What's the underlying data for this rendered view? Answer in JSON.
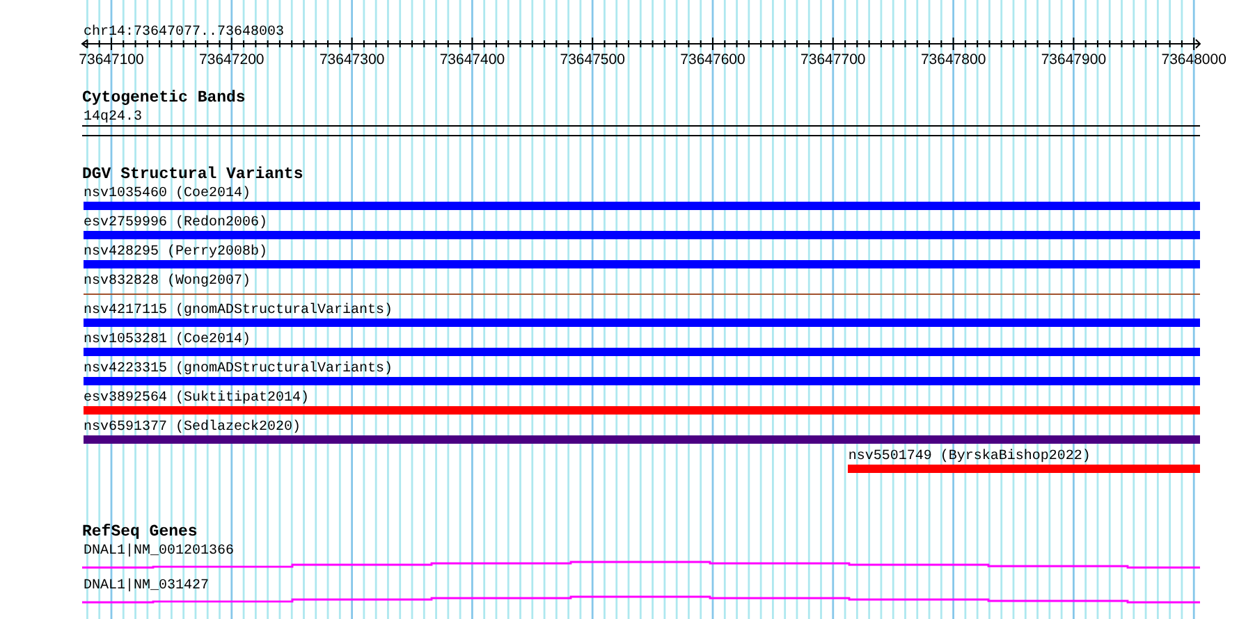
{
  "location": "chr14:73647077..73648003",
  "ruler": {
    "ticks": [
      "73647100",
      "73647200",
      "73647300",
      "73647400",
      "73647500",
      "73647600",
      "73647700",
      "73647800",
      "73647900",
      "73648000"
    ]
  },
  "tracks": [
    {
      "title": "Cytogenetic Bands",
      "kind": "cytoband",
      "features": [
        {
          "label": "14q24.3"
        }
      ]
    },
    {
      "title": "DGV Structural Variants",
      "kind": "variants",
      "features": [
        {
          "label": "nsv1035460 (Coe2014)",
          "kind": "bar",
          "color": "#0000ff",
          "spans_view": true
        },
        {
          "label": "esv2759996 (Redon2006)",
          "kind": "bar",
          "color": "#0000ff",
          "spans_view": true
        },
        {
          "label": "nsv428295 (Perry2008b)",
          "kind": "bar",
          "color": "#0000ff",
          "spans_view": true
        },
        {
          "label": "nsv832828 (Wong2007)",
          "kind": "line",
          "color": "#a0522d",
          "spans_view": true
        },
        {
          "label": "nsv4217115 (gnomADStructuralVariants)",
          "kind": "bar",
          "color": "#0000ff",
          "spans_view": true
        },
        {
          "label": "nsv1053281 (Coe2014)",
          "kind": "bar",
          "color": "#0000ff",
          "spans_view": true
        },
        {
          "label": "nsv4223315 (gnomADStructuralVariants)",
          "kind": "bar",
          "color": "#0000ff",
          "spans_view": true
        },
        {
          "label": "esv3892564 (Suktitipat2014)",
          "kind": "bar",
          "color": "#ff0000",
          "spans_view": true
        },
        {
          "label": "nsv6591377 (Sedlazeck2020)",
          "kind": "bar",
          "color": "#4b0082",
          "spans_view": true
        },
        {
          "label": "nsv5501749 (ByrskaBishop2022)",
          "kind": "bar",
          "color": "#ff0000",
          "spans_view": false
        }
      ]
    },
    {
      "title": "RefSeq Genes",
      "kind": "genes",
      "features": [
        {
          "label": "DNAL1|NM_001201366"
        },
        {
          "label": "DNAL1|NM_031427"
        }
      ]
    }
  ]
}
